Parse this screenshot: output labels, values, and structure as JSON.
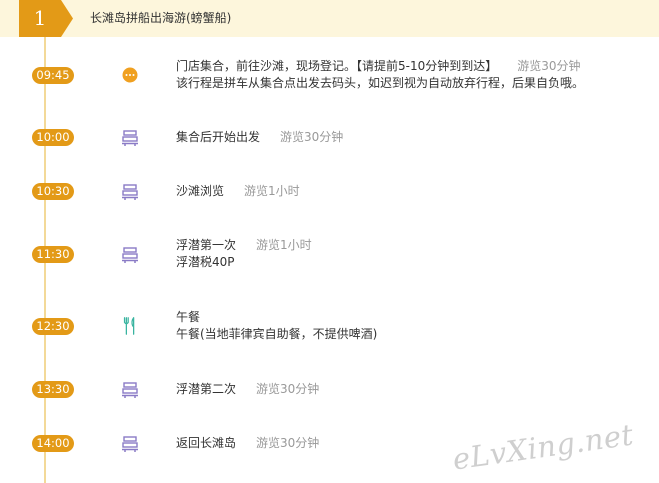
{
  "day": {
    "number": "1",
    "title": "长滩岛拼船出海游(螃蟹船)"
  },
  "colors": {
    "accent": "#e39a17",
    "header_bg": "#fdf6dc",
    "line": "#f3d998",
    "bus_icon": "#8a7bc6",
    "meal_icon": "#39b4a0"
  },
  "items": [
    {
      "time": "09:45",
      "icon": "more-icon",
      "title": "门店集合，前往沙滩，现场登记。【请提前5-10分钟到到达】",
      "duration": "游览30分钟",
      "note": "该行程是拼车从集合点出发去码头，如迟到视为自动放弃行程，后果自负哦。"
    },
    {
      "time": "10:00",
      "icon": "bus-icon",
      "title": "集合后开始出发",
      "duration": "游览30分钟",
      "note": ""
    },
    {
      "time": "10:30",
      "icon": "bus-icon",
      "title": "沙滩浏览",
      "duration": "游览1小时",
      "note": ""
    },
    {
      "time": "11:30",
      "icon": "bus-icon",
      "title": "浮潜第一次",
      "duration": "游览1小时",
      "note": "浮潜税40P"
    },
    {
      "time": "12:30",
      "icon": "meal-icon",
      "title": "午餐",
      "duration": "",
      "note": "午餐(当地菲律宾自助餐，不提供啤酒)"
    },
    {
      "time": "13:30",
      "icon": "bus-icon",
      "title": "浮潜第二次",
      "duration": "游览30分钟",
      "note": ""
    },
    {
      "time": "14:00",
      "icon": "bus-icon",
      "title": "返回长滩岛",
      "duration": "游览30分钟",
      "note": ""
    }
  ],
  "watermark": "eLvXing.net"
}
